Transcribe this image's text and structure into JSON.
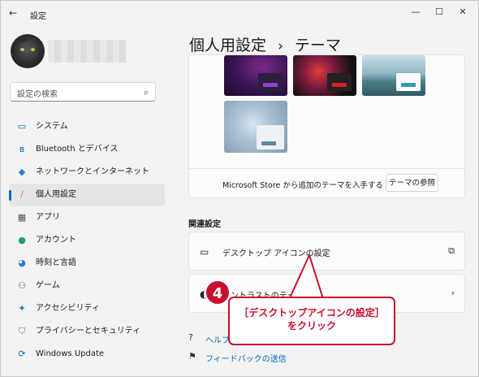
{
  "window": {
    "title": "設定",
    "minimize": "—",
    "maximize": "☐",
    "close": "✕",
    "back": "←"
  },
  "sidebar": {
    "search_placeholder": "設定の検索",
    "items": [
      {
        "label": "システム",
        "icon": "monitor-icon",
        "glyph": "▭",
        "color": "#0a66c2"
      },
      {
        "label": "Bluetooth とデバイス",
        "icon": "bluetooth-icon",
        "glyph": "ʙ",
        "color": "#0067c0"
      },
      {
        "label": "ネットワークとインターネット",
        "icon": "wifi-icon",
        "glyph": "◆",
        "color": "#2a7fd4"
      },
      {
        "label": "個人用設定",
        "icon": "brush-icon",
        "glyph": "/",
        "color": "#d07b2a"
      },
      {
        "label": "アプリ",
        "icon": "apps-icon",
        "glyph": "▦",
        "color": "#555555"
      },
      {
        "label": "アカウント",
        "icon": "person-icon",
        "glyph": "●",
        "color": "#1e9e6a"
      },
      {
        "label": "時刻と言語",
        "icon": "clock-globe-icon",
        "glyph": "◕",
        "color": "#2b7cd3"
      },
      {
        "label": "ゲーム",
        "icon": "gamepad-icon",
        "glyph": "⚇",
        "color": "#666666"
      },
      {
        "label": "アクセシビリティ",
        "icon": "accessibility-icon",
        "glyph": "✦",
        "color": "#1e6fc8"
      },
      {
        "label": "プライバシーとセキュリティ",
        "icon": "shield-icon",
        "glyph": "⛉",
        "color": "#777777"
      },
      {
        "label": "Windows Update",
        "icon": "update-icon",
        "glyph": "⟳",
        "color": "#0067c0"
      }
    ],
    "active_index": 3
  },
  "main": {
    "breadcrumb_parent": "個人用設定",
    "breadcrumb_sep": "›",
    "breadcrumb_current": "テーマ",
    "store_text": "Microsoft Store から追加のテーマを入手する",
    "browse_button": "テーマの参照",
    "related_heading": "関連設定",
    "rows": [
      {
        "label": "デスクトップ アイコンの設定",
        "icon": "desktop-icon",
        "tail": "⧉"
      },
      {
        "label": "コントラストのテーマ",
        "icon": "contrast-icon",
        "tail": "›"
      }
    ],
    "help_link": "ヘルプを表示",
    "feedback_link": "フィードバックの送信"
  },
  "callout": {
    "badge": "4",
    "line1": "［デスクトップアイコンの設定］",
    "line2": "をクリック",
    "color": "#c8102e"
  }
}
